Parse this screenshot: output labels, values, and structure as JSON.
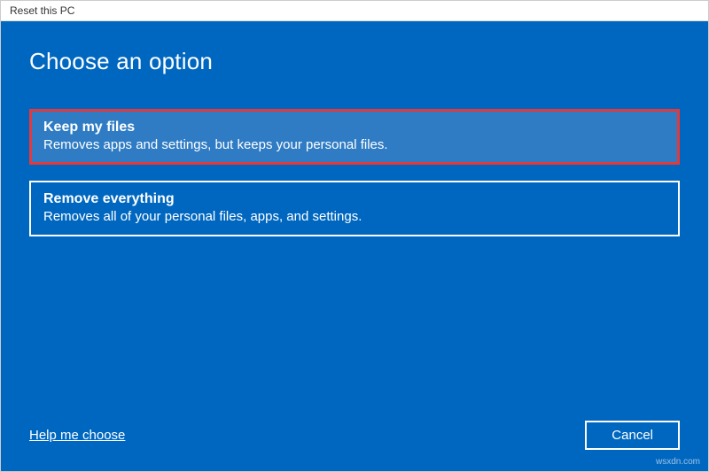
{
  "window": {
    "title": "Reset this PC"
  },
  "heading": "Choose an option",
  "options": [
    {
      "title": "Keep my files",
      "description": "Removes apps and settings, but keeps your personal files."
    },
    {
      "title": "Remove everything",
      "description": "Removes all of your personal files, apps, and settings."
    }
  ],
  "footer": {
    "help_link": "Help me choose",
    "cancel_label": "Cancel"
  },
  "watermark": "wsxdn.com"
}
